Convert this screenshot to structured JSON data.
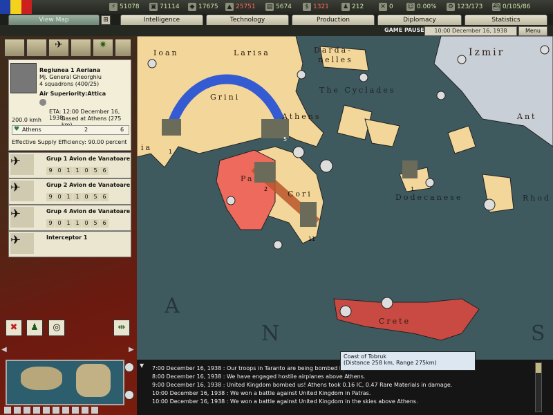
{
  "resources": [
    {
      "icon": "energy-icon",
      "value": "51078"
    },
    {
      "icon": "metal-icon",
      "value": "71114"
    },
    {
      "icon": "rare-materials-icon",
      "value": "17675"
    },
    {
      "icon": "oil-icon",
      "value": "25751",
      "warn": true
    },
    {
      "icon": "supplies-icon",
      "value": "5674"
    },
    {
      "icon": "money-icon",
      "value": "1321",
      "warn": true
    },
    {
      "icon": "manpower-icon",
      "value": "212"
    },
    {
      "icon": "transport-icon",
      "value": "0"
    },
    {
      "icon": "dissent-icon",
      "value": "0.00%"
    },
    {
      "icon": "ic-icon",
      "value": "123/173"
    },
    {
      "icon": "convoy-icon",
      "value": "0/105/86"
    }
  ],
  "tabs": [
    "View Map",
    "Intelligence",
    "Technology",
    "Production",
    "Diplomacy",
    "Statistics"
  ],
  "status": {
    "paused": "GAME PAUSED",
    "date": "10:00 December 16, 1938",
    "menu": "Menu"
  },
  "unit": {
    "name": "Regiunea 1 Aeriana",
    "commander": "Mj. General Gheorghiu",
    "strength": "4 squadrons (400/25)",
    "mission": "Air Superiority:Attica",
    "eta": "ETA: 12:00 December 16, 1938.",
    "based": "Based at Athens (275 km)",
    "speed": "200.0 kmh",
    "base": "Athens",
    "base_count": "2",
    "base_count2": "6",
    "supply": "Effective Supply Efficiency: 90.00 percent"
  },
  "squadrons": [
    {
      "name": "Grup 1 Avion de Vanatoare",
      "stats": [
        "9",
        "0",
        "1",
        "1",
        "0",
        "5",
        "6"
      ]
    },
    {
      "name": "Grup 2 Avion de Vanatoare",
      "stats": [
        "9",
        "0",
        "1",
        "1",
        "0",
        "5",
        "6"
      ]
    },
    {
      "name": "Grup 4 Avion de Vanatoare",
      "stats": [
        "9",
        "0",
        "1",
        "1",
        "0",
        "5",
        "6"
      ]
    },
    {
      "name": "Interceptor 1",
      "stats": []
    }
  ],
  "map_labels": {
    "ioannina": "Ioan",
    "larisa": "Larisa",
    "dardanelles1": "Darda-",
    "dardanelles2": "nelles",
    "izmir": "Izmir",
    "cyclades": "The Cyclades",
    "corinth": "Cori",
    "athens": "Athens",
    "patras": "Patras",
    "dodecanese": "Dodecanese",
    "rhodes": "Rhod",
    "antalya": "Ant",
    "crete": "Crete",
    "sea_a": "A",
    "sea_n": "N",
    "sea_s": "S",
    "grini": "Grini",
    "ia": "ia"
  },
  "unit_counts": {
    "athens_air": "5",
    "patras": "2",
    "corinth": "11",
    "dodecanese": "1",
    "west": "1"
  },
  "tooltip": {
    "line1": "Coast of Tobruk",
    "line2": "(Distance 258 km, Range 275km)"
  },
  "log": [
    "7:00 December 16, 1938 : Our troops in Taranto are being bombed by Aus",
    "8:00 December 16, 1938 : We have engaged hostile airplanes above Athens.",
    "9:00 December 16, 1938 : United Kingdom bombed us!  Athens took 0.16 IC, 0.47 Rare Materials in damage.",
    "10:00 December 16, 1938 : We won a battle against United Kingdom in Patras.",
    "10:00 December 16, 1938 : We won a battle against United Kingdom in the skies above Athens."
  ],
  "colors": {
    "sea": "#3f5a5f",
    "greece": "#f3d79a",
    "enemy": "#ee6a5d",
    "crete": "#c84a42",
    "turkey": "#c8cfd6"
  }
}
